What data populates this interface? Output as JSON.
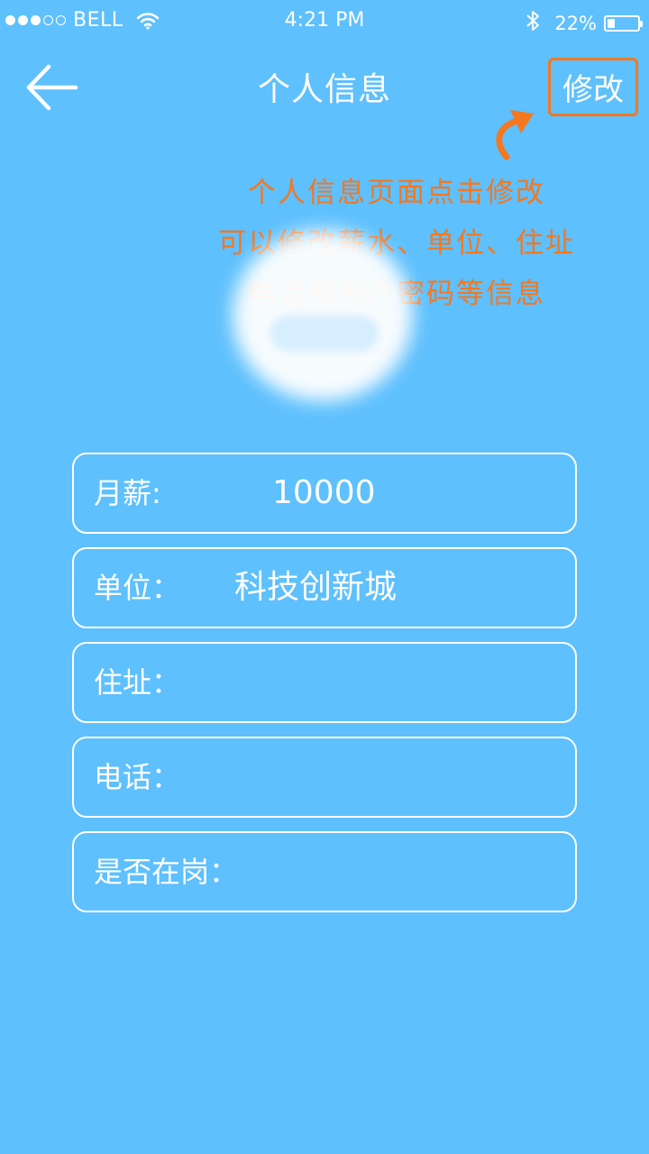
{
  "status_bar": {
    "carrier": "BELL",
    "time": "4:21 PM",
    "battery_text": "22%",
    "battery_level": 0.22,
    "signal_filled": 3,
    "signal_total": 5
  },
  "nav": {
    "title": "个人信息",
    "edit_label": "修改"
  },
  "annotation": {
    "line1": "个人信息页面点击修改",
    "line2": "可以修改薪水、单位、住址",
    "line3": "电话和用户密码等信息"
  },
  "fields": [
    {
      "label": "月薪:",
      "value": "10000"
    },
    {
      "label": "单位：",
      "value": "科技创新城"
    },
    {
      "label": "住址：",
      "value": ""
    },
    {
      "label": "电话：",
      "value": ""
    },
    {
      "label": "是否在岗：",
      "value": ""
    }
  ],
  "colors": {
    "background": "#5ec0fd",
    "accent_orange": "#f47721",
    "text": "#ffffff"
  },
  "icons": {
    "back": "arrow-left-icon",
    "wifi": "wifi-icon",
    "bluetooth": "bluetooth-icon",
    "battery": "battery-icon",
    "annotation_arrow": "curved-arrow-icon"
  }
}
